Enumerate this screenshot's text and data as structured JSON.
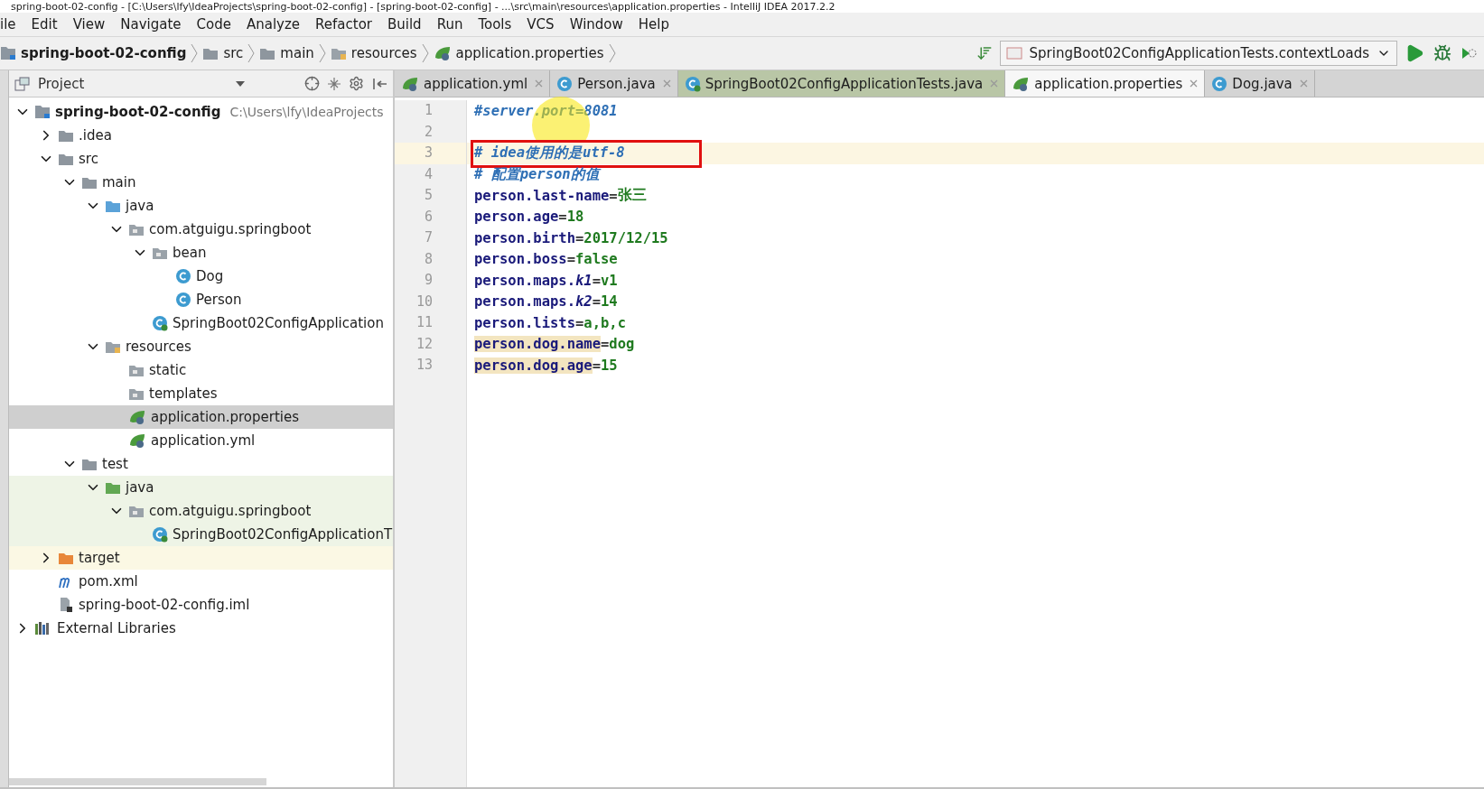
{
  "window": {
    "title": "spring-boot-02-config - [C:\\Users\\lfy\\IdeaProjects\\spring-boot-02-config] - [spring-boot-02-config] - ...\\src\\main\\resources\\application.properties - IntelliJ IDEA 2017.2.2"
  },
  "menu": [
    "ile",
    "Edit",
    "View",
    "Navigate",
    "Code",
    "Analyze",
    "Refactor",
    "Build",
    "Run",
    "Tools",
    "VCS",
    "Window",
    "Help"
  ],
  "breadcrumbs": [
    {
      "label": "spring-boot-02-config",
      "kind": "module"
    },
    {
      "label": "src",
      "kind": "folder"
    },
    {
      "label": "main",
      "kind": "folder"
    },
    {
      "label": "resources",
      "kind": "resources"
    },
    {
      "label": "application.properties",
      "kind": "spring"
    }
  ],
  "run_config": {
    "value": "SpringBoot02ConfigApplicationTests.contextLoads"
  },
  "project_panel": {
    "title": "Project"
  },
  "tree": [
    {
      "label": "spring-boot-02-config",
      "kind": "module",
      "expanded": true,
      "selected": false,
      "note": "C:\\Users\\lfy\\IdeaProjects",
      "children": [
        {
          "label": ".idea",
          "kind": "folder",
          "expanded": false,
          "selected": false
        },
        {
          "label": "src",
          "kind": "folder",
          "expanded": true,
          "selected": false,
          "children": [
            {
              "label": "main",
              "kind": "folder",
              "expanded": true,
              "selected": false,
              "children": [
                {
                  "label": "java",
                  "kind": "source",
                  "expanded": true,
                  "selected": false,
                  "children": [
                    {
                      "label": "com.atguigu.springboot",
                      "kind": "package",
                      "expanded": true,
                      "selected": false,
                      "children": [
                        {
                          "label": "bean",
                          "kind": "package",
                          "expanded": true,
                          "selected": false,
                          "children": [
                            {
                              "label": "Dog",
                              "kind": "class",
                              "selected": false
                            },
                            {
                              "label": "Person",
                              "kind": "class",
                              "selected": false
                            }
                          ]
                        },
                        {
                          "label": "SpringBoot02ConfigApplication",
                          "kind": "spring-class",
                          "selected": false
                        }
                      ]
                    }
                  ]
                },
                {
                  "label": "resources",
                  "kind": "resources",
                  "expanded": true,
                  "selected": false,
                  "children": [
                    {
                      "label": "static",
                      "kind": "package",
                      "selected": false
                    },
                    {
                      "label": "templates",
                      "kind": "package",
                      "selected": false
                    },
                    {
                      "label": "application.properties",
                      "kind": "spring",
                      "selected": true
                    },
                    {
                      "label": "application.yml",
                      "kind": "spring",
                      "selected": false
                    }
                  ]
                }
              ]
            },
            {
              "label": "test",
              "kind": "folder",
              "expanded": true,
              "selected": false,
              "children": [
                {
                  "label": "java",
                  "kind": "test-source",
                  "expanded": true,
                  "selected": false,
                  "test_scope": true,
                  "children": [
                    {
                      "label": "com.atguigu.springboot",
                      "kind": "package",
                      "expanded": true,
                      "selected": false,
                      "test_scope": true,
                      "children": [
                        {
                          "label": "SpringBoot02ConfigApplicationT",
                          "kind": "test-class",
                          "selected": false,
                          "test_scope": true
                        }
                      ]
                    }
                  ]
                }
              ]
            }
          ]
        },
        {
          "label": "target",
          "kind": "excluded",
          "expanded": false,
          "selected": false,
          "excluded": true
        },
        {
          "label": "pom.xml",
          "kind": "maven",
          "selected": false
        },
        {
          "label": "spring-boot-02-config.iml",
          "kind": "iml",
          "selected": false
        }
      ]
    },
    {
      "label": "External Libraries",
      "kind": "libraries",
      "expanded": false,
      "selected": false
    }
  ],
  "tabs": [
    {
      "label": "application.yml",
      "kind": "spring",
      "selected": false
    },
    {
      "label": "Person.java",
      "kind": "class",
      "selected": false
    },
    {
      "label": "SpringBoot02ConfigApplicationTests.java",
      "kind": "test-class",
      "selected": false
    },
    {
      "label": "application.properties",
      "kind": "spring",
      "selected": true
    },
    {
      "label": "Dog.java",
      "kind": "class",
      "selected": false
    }
  ],
  "lines": [
    {
      "number": "1",
      "current": false,
      "pointer": true,
      "segments": [
        {
          "text": "#server.port=8081",
          "kind": "comment"
        }
      ]
    },
    {
      "number": "2",
      "current": false
    },
    {
      "number": "3",
      "current": true,
      "boxed": true,
      "segments": [
        {
          "text": "# idea使用的是utf-8",
          "kind": "comment"
        }
      ]
    },
    {
      "number": "4",
      "current": false,
      "segments": [
        {
          "text": "# 配置person的值",
          "kind": "comment"
        }
      ]
    },
    {
      "number": "5",
      "current": false,
      "segments": [
        {
          "text": "person.last-name",
          "kind": "key"
        },
        {
          "text": "=",
          "kind": "sep"
        },
        {
          "text": "张三",
          "kind": "value"
        }
      ]
    },
    {
      "number": "6",
      "current": false,
      "segments": [
        {
          "text": "person.age",
          "kind": "key"
        },
        {
          "text": "=",
          "kind": "sep"
        },
        {
          "text": "18",
          "kind": "value"
        }
      ]
    },
    {
      "number": "7",
      "current": false,
      "segments": [
        {
          "text": "person.birth",
          "kind": "key"
        },
        {
          "text": "=",
          "kind": "sep"
        },
        {
          "text": "2017/12/15",
          "kind": "value"
        }
      ]
    },
    {
      "number": "8",
      "current": false,
      "segments": [
        {
          "text": "person.boss",
          "kind": "key"
        },
        {
          "text": "=",
          "kind": "sep"
        },
        {
          "text": "false",
          "kind": "value"
        }
      ]
    },
    {
      "number": "9",
      "current": false,
      "segments": [
        {
          "text": "person.maps.*k1*",
          "kind": "key"
        },
        {
          "text": "=",
          "kind": "sep"
        },
        {
          "text": "v1",
          "kind": "value"
        }
      ]
    },
    {
      "number": "10",
      "current": false,
      "segments": [
        {
          "text": "person.maps.*k2*",
          "kind": "key"
        },
        {
          "text": "=",
          "kind": "sep"
        },
        {
          "text": "14",
          "kind": "value"
        }
      ]
    },
    {
      "number": "11",
      "current": false,
      "segments": [
        {
          "text": "person.lists",
          "kind": "key"
        },
        {
          "text": "=",
          "kind": "sep"
        },
        {
          "text": "a,b,c",
          "kind": "value"
        }
      ]
    },
    {
      "number": "12",
      "current": false,
      "segments": [
        {
          "text": "person.dog.name",
          "kind": "key",
          "highlighted": true
        },
        {
          "text": "=",
          "kind": "sep"
        },
        {
          "text": "dog",
          "kind": "value"
        }
      ]
    },
    {
      "number": "13",
      "current": false,
      "segments": [
        {
          "text": "person.dog.age",
          "kind": "key",
          "highlighted": true
        },
        {
          "text": "=",
          "kind": "sep"
        },
        {
          "text": "15",
          "kind": "value"
        }
      ]
    }
  ]
}
